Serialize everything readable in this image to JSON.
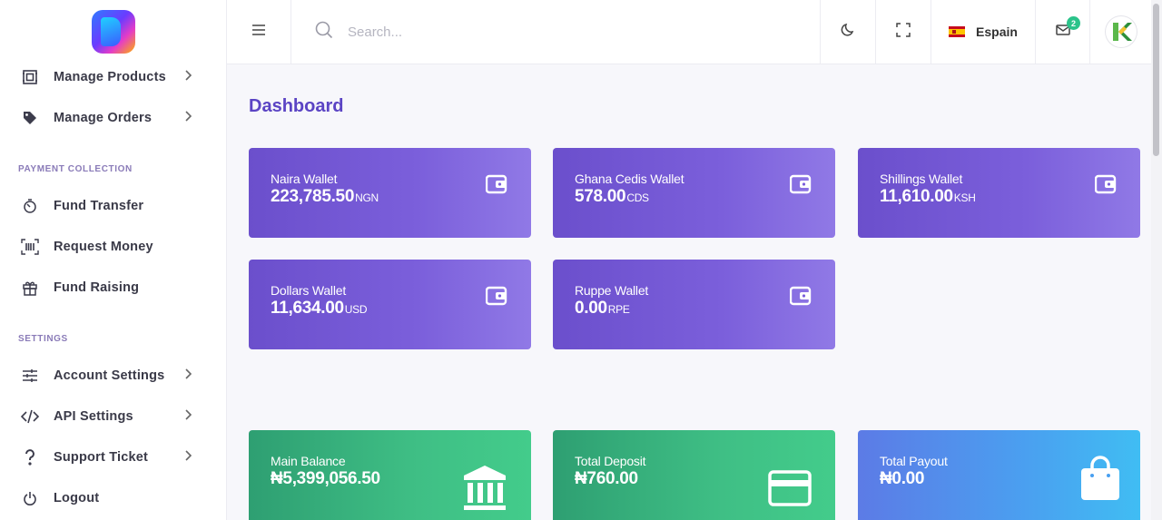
{
  "sidebar": {
    "items_top": [
      {
        "label": "Manage Products",
        "icon": "frame-icon",
        "has_submenu": true
      },
      {
        "label": "Manage Orders",
        "icon": "tag-icon",
        "has_submenu": true
      }
    ],
    "payment_section": "PAYMENT COLLECTION",
    "payment_items": [
      {
        "label": "Fund Transfer",
        "icon": "timer-icon"
      },
      {
        "label": "Request Money",
        "icon": "barcode-icon"
      },
      {
        "label": "Fund Raising",
        "icon": "gift-icon"
      }
    ],
    "settings_section": "SETTINGS",
    "settings_items": [
      {
        "label": "Account Settings",
        "icon": "sliders-icon",
        "has_submenu": true
      },
      {
        "label": "API Settings",
        "icon": "code-icon",
        "has_submenu": true
      },
      {
        "label": "Support Ticket",
        "icon": "question-icon",
        "has_submenu": true
      },
      {
        "label": "Logout",
        "icon": "power-icon"
      }
    ]
  },
  "topbar": {
    "search_placeholder": "Search...",
    "language": "Espain",
    "mail_count": "2"
  },
  "page": {
    "title": "Dashboard"
  },
  "wallets": [
    {
      "label": "Naira Wallet",
      "value": "223,785.50",
      "unit": "NGN"
    },
    {
      "label": "Ghana Cedis Wallet",
      "value": "578.00",
      "unit": "CDS"
    },
    {
      "label": "Shillings Wallet",
      "value": "11,610.00",
      "unit": "KSH"
    },
    {
      "label": "Dollars Wallet",
      "value": "11,634.00",
      "unit": "USD"
    },
    {
      "label": "Ruppe Wallet",
      "value": "0.00",
      "unit": "RPE"
    }
  ],
  "stats": [
    {
      "label": "Main Balance",
      "value": "₦5,399,056.50",
      "icon": "bank-icon"
    },
    {
      "label": "Total Deposit",
      "value": "₦760.00",
      "icon": "credit-card-icon"
    },
    {
      "label": "Total Payout",
      "value": "₦0.00",
      "icon": "shopping-bag-icon"
    }
  ],
  "colors": {
    "accent": "#5b44c4",
    "wallet_card": "#7b5fdb",
    "green_card": "#3fbf85",
    "blue_card": "#4aa0f0",
    "badge": "#2bc38a"
  }
}
